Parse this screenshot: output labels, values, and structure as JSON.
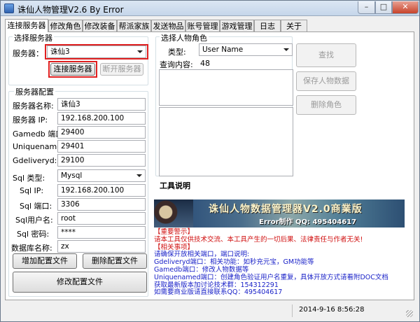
{
  "window": {
    "title": "诛仙人物管理V2.6 By Error",
    "controls": {
      "minimize": "–",
      "maximize": "□",
      "close": "✕"
    }
  },
  "tabs": [
    "连接服务器",
    "修改角色",
    "修改装备",
    "帮派家族",
    "发送物品",
    "账号管理",
    "游戏管理",
    "日志",
    "关于"
  ],
  "active_tab": "连接服务器",
  "server_select": {
    "group_title": "选择服务器",
    "server_label": "服务器：",
    "server_value": "诛仙3",
    "connect_button": "连接服务器",
    "disconnect_button": "断开服务器"
  },
  "server_config": {
    "group_title": "服务器配置",
    "fields": [
      {
        "label": "服务器名称:",
        "value": "诛仙3"
      },
      {
        "label": "服务器 IP:",
        "value": "192.168.200.100"
      },
      {
        "label": "Gamedb 端口:",
        "value": "29400"
      },
      {
        "label": "Uniquenamed:",
        "value": "29401"
      },
      {
        "label": "Gdeliveryd:",
        "value": "29100"
      }
    ],
    "sql": {
      "type_label": "Sql 类型:",
      "type_value": "Mysql",
      "ip_label": "Sql IP:",
      "ip_value": "192.168.200.100",
      "port_label": "Sql 端口:",
      "port_value": "3306",
      "user_label": "Sql用户名:",
      "user_value": "root",
      "password_label": "Sql 密码:",
      "password_value": "****",
      "db_label": "数据库名称:",
      "db_value": "zx"
    },
    "add_button": "增加配置文件",
    "delete_button": "删除配置文件",
    "modify_button": "修改配置文件"
  },
  "character_select": {
    "group_title": "选择人物角色",
    "type_label": "类型:",
    "type_value": "User Name",
    "query_label": "查询内容:",
    "query_value": "48",
    "find_button": "查找",
    "save_button": "保存人物数据",
    "delete_button": "删除角色"
  },
  "tool_info": {
    "title": "工具说明",
    "banner_title": "诛仙人物数据管理器V2.0商業版",
    "banner_sub": "Error制作 QQ: 495404617",
    "notes": [
      {
        "text": "【重要警示】",
        "color": "red"
      },
      {
        "text": "请本工具仅供技术交流、本工具产生的一切后果、法律责任与作者无关!",
        "color": "red"
      },
      {
        "text": "【相关事项】",
        "color": "red"
      },
      {
        "text": "请确保开放相关端口，端口说明:",
        "color": "blue"
      },
      {
        "text": "Gdeliveryd端口：相关功能：如秒充元宝，GM功能等",
        "color": "blue"
      },
      {
        "text": "Gamedb端口：修改人物数据等",
        "color": "blue"
      },
      {
        "text": "Uniquenamed端口：创建角色验证用户名重复，具体开放方式请看附DOC文档",
        "color": "blue"
      },
      {
        "text": "获取最新版本加讨论技术群：154312291",
        "color": "blue"
      },
      {
        "text": "如需要商业版请直接联系QQ：495404617",
        "color": "blue"
      }
    ]
  },
  "status": {
    "datetime": "2014-9-16  8:56:28"
  }
}
